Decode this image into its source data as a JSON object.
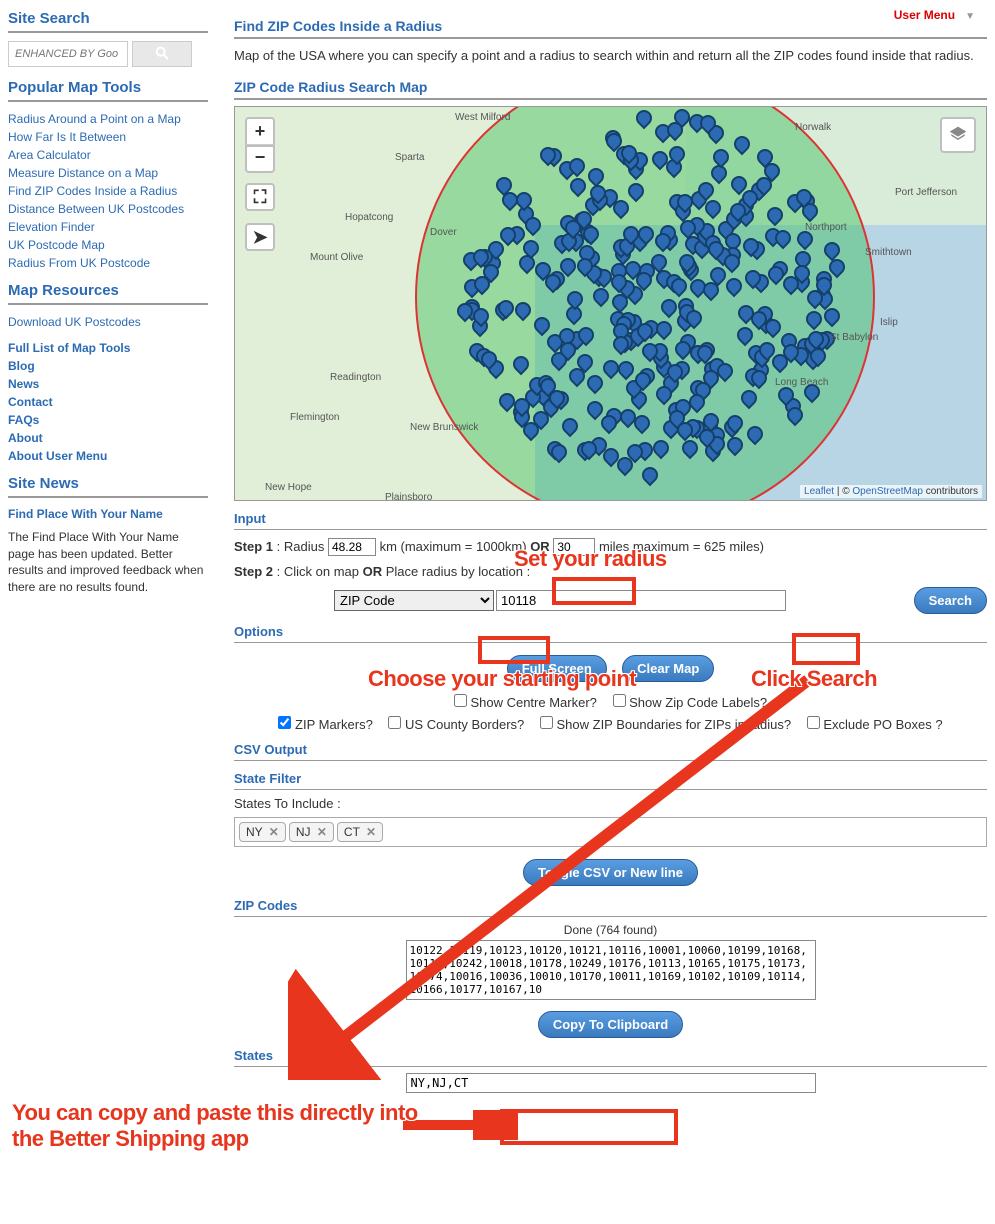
{
  "user_menu": "User Menu",
  "sidebar": {
    "site_search": "Site Search",
    "search_placeholder": "ENHANCED BY Goo",
    "popular_title": "Popular Map Tools",
    "popular": [
      "Radius Around a Point on a Map",
      "How Far Is It Between",
      "Area Calculator",
      "Measure Distance on a Map",
      "Find ZIP Codes Inside a Radius",
      "Distance Between UK Postcodes",
      "Elevation Finder",
      "UK Postcode Map",
      "Radius From UK Postcode"
    ],
    "resources_title": "Map Resources",
    "resources": [
      "Download UK Postcodes"
    ],
    "main_nav": [
      "Full List of Map Tools",
      "Blog",
      "News",
      "Contact",
      "FAQs",
      "About",
      "About User Menu"
    ],
    "site_news_title": "Site News",
    "news_link": "Find Place With Your Name",
    "news_text": "The Find Place With Your Name page has been updated. Better results and improved feedback when there are no results found."
  },
  "main": {
    "title": "Find ZIP Codes Inside a Radius",
    "desc": "Map of the USA where you can specify a point and a radius to search within and return all the ZIP codes found inside that radius.",
    "map_title": "ZIP Code Radius Search Map",
    "attrib_leaflet": "Leaflet",
    "attrib_mid": " | © ",
    "attrib_osm": "OpenStreetMap",
    "attrib_tail": " contributors",
    "map_labels": [
      "West Milford",
      "Norwalk",
      "Sparta",
      "Hopatcong",
      "Dover",
      "Mount Olive",
      "Readington",
      "Flemington",
      "New Brunswick",
      "New Hope",
      "Plainsboro",
      "Port Jefferson",
      "Smithtown",
      "Northport",
      "Islip",
      "St Babylon",
      "Long Beach"
    ],
    "input_title": "Input",
    "step1a": "Step 1",
    "step1b": " : Radius ",
    "km_val": "48.28",
    "km_txt": " km (maximum = 1000km) ",
    "or": "OR",
    "miles_val": "30",
    "miles_txt": "  miles ",
    "miles_max": "maximum = 625 miles)",
    "step2a": "Step 2",
    "step2b": " : Click on map ",
    "step2c": " Place radius by location :",
    "loc_type": "ZIP Code",
    "loc_val": "10118",
    "search": "Search",
    "options_title": "Options",
    "full_screen": "Full Screen",
    "clear_map": "Clear Map",
    "chk_centre": " Show Centre Marker?",
    "chk_labels": " Show Zip Code Labels?",
    "chk_zip": " ZIP Markers?",
    "chk_county": " US County Borders?",
    "chk_bound": " Show ZIP Boundaries for ZIPs in radius?",
    "chk_po": " Exclude PO Boxes ?",
    "csv_title": "CSV Output",
    "filter_title": "State Filter",
    "states_include": "States To Include :",
    "chips": [
      "NY",
      "NJ",
      "CT"
    ],
    "toggle": "Toggle CSV or New line",
    "zipcodes_title": "ZIP Codes",
    "done": "Done (764 found)",
    "zip_output": "10122,10119,10123,10120,10121,10116,10001,10060,10199,10168,10110,10242,10018,10178,10249,10176,10113,10165,10175,10173,10174,10016,10036,10010,10170,10011,10169,10102,10109,10114,10166,10177,10167,10",
    "copy": "Copy To Clipboard",
    "states_title": "States",
    "states_out": "NY,NJ,CT"
  },
  "annot": {
    "radius": "Set your radius",
    "starting": "Choose your starting point",
    "search": "Click Search",
    "copy1": "You can copy and paste this directly into",
    "copy2": "the Better Shipping app"
  }
}
